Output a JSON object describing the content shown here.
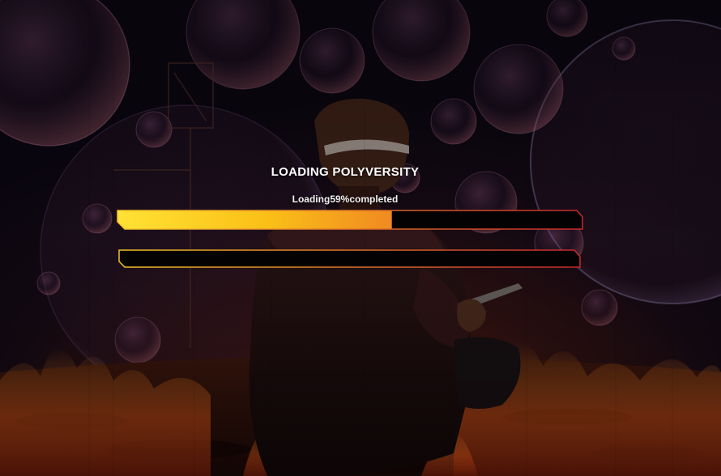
{
  "loading": {
    "title": "LOADING POLYVERSITY",
    "status_prefix": "Loading",
    "status_suffix": "%completed",
    "progress_percent": 59
  },
  "colors": {
    "fill_start": "#ffe234",
    "fill_mid": "#fbbf17",
    "fill_end": "#f08a22",
    "track": "#050204",
    "border_start": "#f2c22a",
    "border_end": "#c8282c"
  },
  "background": {
    "scene": "silhouette of a person kneeling among floating bubbles and fire"
  }
}
